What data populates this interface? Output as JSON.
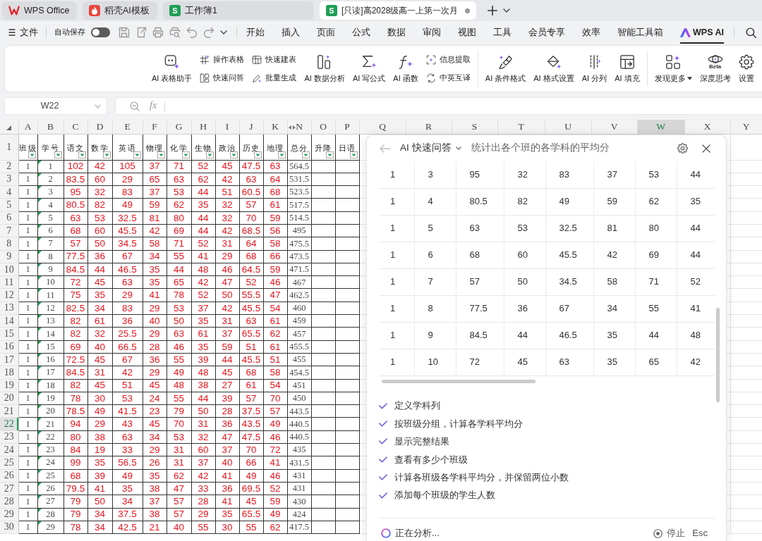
{
  "tabs": [
    {
      "title": "WPS Office",
      "kind": "wps",
      "selected": false,
      "modified": false
    },
    {
      "title": "稻壳AI模板",
      "kind": "docer",
      "selected": false,
      "modified": false
    },
    {
      "title": "工作簿1",
      "kind": "sheet",
      "logo": "S",
      "selected": false,
      "modified": false
    },
    {
      "title": "[只读]高2028级高一上第一次月",
      "kind": "sheet",
      "logo": "S",
      "selected": true,
      "modified": true
    }
  ],
  "menu": {
    "file": "文件",
    "autosave": {
      "label": "自动保存",
      "on": false
    },
    "tabs": [
      {
        "label": "开始",
        "kind": "plain",
        "selected": false
      },
      {
        "label": "插入",
        "kind": "plain",
        "selected": false
      },
      {
        "label": "页面",
        "kind": "plain",
        "selected": false
      },
      {
        "label": "公式",
        "kind": "plain",
        "selected": false
      },
      {
        "label": "数据",
        "kind": "plain",
        "selected": false
      },
      {
        "label": "审阅",
        "kind": "plain",
        "selected": false
      },
      {
        "label": "视图",
        "kind": "plain",
        "selected": false
      },
      {
        "label": "工具",
        "kind": "plain",
        "selected": false
      },
      {
        "label": "会员专享",
        "kind": "plain",
        "selected": false
      },
      {
        "label": "效率",
        "kind": "plain",
        "selected": false
      },
      {
        "label": "智能工具箱",
        "kind": "plain",
        "selected": false
      },
      {
        "label": "WPS AI",
        "kind": "ai",
        "selected": true
      }
    ]
  },
  "ribbon": {
    "groups": [
      [
        {
          "kind": "large",
          "label": "AI 表格助手"
        },
        {
          "kind": "pair",
          "items": [
            "操作表格",
            "快速问答"
          ]
        },
        {
          "kind": "pair",
          "items": [
            "快速建表",
            "批量生成"
          ]
        },
        {
          "kind": "large",
          "label": "AI 数据分析"
        },
        {
          "kind": "large",
          "label": "AI 写公式"
        },
        {
          "kind": "large",
          "label": "AI 函数"
        },
        {
          "kind": "pair",
          "items": [
            "信息提取",
            "中英互译"
          ]
        }
      ],
      [
        {
          "kind": "large",
          "label": "AI 条件格式"
        },
        {
          "kind": "large",
          "label": "AI 格式设置"
        },
        {
          "kind": "large",
          "label": "AI 分列"
        },
        {
          "kind": "large",
          "label": "AI 填充"
        }
      ],
      [
        {
          "kind": "large",
          "label": "发现更多",
          "menu": true
        },
        {
          "kind": "large",
          "label": "深度思考",
          "badge": "Beta"
        },
        {
          "kind": "large",
          "label": "设置"
        }
      ]
    ]
  },
  "formula_bar": {
    "name_box": "W22",
    "function_label": "fx"
  },
  "sheet": {
    "header_row": "1",
    "columns": [
      {
        "letter": "A",
        "header": "班级",
        "kind": "plain",
        "selected": false
      },
      {
        "letter": "B",
        "header": "学号",
        "kind": "text",
        "selected": false
      },
      {
        "letter": "C",
        "header": "语文",
        "kind": "score",
        "selected": false
      },
      {
        "letter": "D",
        "header": "数学",
        "kind": "score",
        "selected": false
      },
      {
        "letter": "E",
        "header": "英语",
        "kind": "score",
        "selected": false
      },
      {
        "letter": "F",
        "header": "物理",
        "kind": "score",
        "selected": false
      },
      {
        "letter": "G",
        "header": "化学",
        "kind": "score",
        "selected": false
      },
      {
        "letter": "H",
        "header": "生物",
        "kind": "score",
        "selected": false
      },
      {
        "letter": "I",
        "header": "政治",
        "kind": "score",
        "selected": false
      },
      {
        "letter": "J",
        "header": "历史",
        "kind": "score",
        "selected": false
      },
      {
        "letter": "K",
        "header": "地理",
        "kind": "score",
        "selected": false
      },
      {
        "letter": "N",
        "header": "总分",
        "kind": "plain",
        "selected": false,
        "hidden_before": true
      },
      {
        "letter": "O",
        "header": "升降",
        "kind": "plain",
        "selected": false
      },
      {
        "letter": "P",
        "header": "日语",
        "kind": "plain",
        "selected": false
      }
    ],
    "more_columns": [
      {
        "letter": "Q",
        "selected": false
      },
      {
        "letter": "R",
        "selected": false
      },
      {
        "letter": "S",
        "selected": false
      },
      {
        "letter": "T",
        "selected": false
      },
      {
        "letter": "U",
        "selected": false
      },
      {
        "letter": "V",
        "selected": false
      },
      {
        "letter": "W",
        "selected": true
      },
      {
        "letter": "X",
        "selected": false
      },
      {
        "letter": "Y",
        "selected": false
      }
    ],
    "rows": [
      {
        "number": "2",
        "selected": false,
        "error_mark": true,
        "cells": [
          "1",
          "1",
          "102",
          "42",
          "105",
          "37",
          "71",
          "52",
          "45",
          "47.5",
          "63",
          "564.5"
        ]
      },
      {
        "number": "3",
        "selected": false,
        "error_mark": true,
        "cells": [
          "1",
          "2",
          "83.5",
          "60",
          "29",
          "65",
          "63",
          "62",
          "42",
          "63",
          "64",
          "531.5"
        ]
      },
      {
        "number": "4",
        "selected": false,
        "error_mark": true,
        "cells": [
          "1",
          "3",
          "95",
          "32",
          "83",
          "37",
          "53",
          "44",
          "51",
          "60.5",
          "68",
          "523.5"
        ]
      },
      {
        "number": "5",
        "selected": false,
        "error_mark": true,
        "cells": [
          "1",
          "4",
          "80.5",
          "82",
          "49",
          "59",
          "62",
          "35",
          "32",
          "57",
          "61",
          "517.5"
        ]
      },
      {
        "number": "6",
        "selected": false,
        "error_mark": true,
        "cells": [
          "1",
          "5",
          "63",
          "53",
          "32.5",
          "81",
          "80",
          "44",
          "32",
          "70",
          "59",
          "514.5"
        ]
      },
      {
        "number": "7",
        "selected": false,
        "error_mark": true,
        "cells": [
          "1",
          "6",
          "68",
          "60",
          "45.5",
          "42",
          "69",
          "44",
          "42",
          "68.5",
          "56",
          "495"
        ]
      },
      {
        "number": "8",
        "selected": false,
        "error_mark": true,
        "cells": [
          "1",
          "7",
          "57",
          "50",
          "34.5",
          "58",
          "71",
          "52",
          "31",
          "64",
          "58",
          "475.5"
        ]
      },
      {
        "number": "9",
        "selected": false,
        "error_mark": true,
        "cells": [
          "1",
          "8",
          "77.5",
          "36",
          "67",
          "34",
          "55",
          "41",
          "29",
          "68",
          "66",
          "473.5"
        ]
      },
      {
        "number": "10",
        "selected": false,
        "error_mark": true,
        "cells": [
          "1",
          "9",
          "84.5",
          "44",
          "46.5",
          "35",
          "44",
          "48",
          "46",
          "64.5",
          "59",
          "471.5"
        ]
      },
      {
        "number": "11",
        "selected": false,
        "error_mark": true,
        "cells": [
          "1",
          "10",
          "72",
          "45",
          "63",
          "35",
          "65",
          "42",
          "47",
          "52",
          "46",
          "467"
        ]
      },
      {
        "number": "12",
        "selected": false,
        "error_mark": true,
        "cells": [
          "1",
          "11",
          "75",
          "35",
          "29",
          "41",
          "78",
          "52",
          "50",
          "55.5",
          "47",
          "462.5"
        ]
      },
      {
        "number": "13",
        "selected": false,
        "error_mark": true,
        "cells": [
          "1",
          "12",
          "82.5",
          "34",
          "83",
          "29",
          "53",
          "37",
          "42",
          "45.5",
          "54",
          "460"
        ]
      },
      {
        "number": "14",
        "selected": false,
        "error_mark": true,
        "cells": [
          "1",
          "13",
          "82",
          "61",
          "36",
          "40",
          "50",
          "35",
          "31",
          "63",
          "61",
          "459"
        ]
      },
      {
        "number": "15",
        "selected": false,
        "error_mark": true,
        "cells": [
          "1",
          "14",
          "82",
          "32",
          "25.5",
          "29",
          "63",
          "61",
          "37",
          "65.5",
          "62",
          "457"
        ]
      },
      {
        "number": "16",
        "selected": false,
        "error_mark": true,
        "cells": [
          "1",
          "15",
          "69",
          "40",
          "66.5",
          "28",
          "46",
          "35",
          "59",
          "51",
          "61",
          "455.5"
        ]
      },
      {
        "number": "17",
        "selected": false,
        "error_mark": true,
        "cells": [
          "1",
          "16",
          "72.5",
          "45",
          "67",
          "36",
          "55",
          "39",
          "44",
          "45.5",
          "51",
          "455"
        ]
      },
      {
        "number": "18",
        "selected": false,
        "error_mark": true,
        "cells": [
          "1",
          "17",
          "84.5",
          "31",
          "42",
          "29",
          "49",
          "48",
          "45",
          "68",
          "58",
          "454.5"
        ]
      },
      {
        "number": "19",
        "selected": false,
        "error_mark": true,
        "cells": [
          "1",
          "18",
          "82",
          "45",
          "51",
          "45",
          "48",
          "38",
          "27",
          "61",
          "54",
          "451"
        ]
      },
      {
        "number": "20",
        "selected": false,
        "error_mark": true,
        "cells": [
          "1",
          "19",
          "78",
          "30",
          "53",
          "24",
          "55",
          "44",
          "39",
          "57",
          "70",
          "450"
        ]
      },
      {
        "number": "21",
        "selected": false,
        "error_mark": true,
        "cells": [
          "1",
          "20",
          "78.5",
          "49",
          "41.5",
          "23",
          "79",
          "50",
          "28",
          "37.5",
          "57",
          "443.5"
        ]
      },
      {
        "number": "22",
        "selected": true,
        "error_mark": true,
        "cells": [
          "1",
          "21",
          "94",
          "29",
          "43",
          "45",
          "70",
          "31",
          "36",
          "43.5",
          "49",
          "440.5"
        ]
      },
      {
        "number": "23",
        "selected": false,
        "error_mark": true,
        "cells": [
          "1",
          "22",
          "80",
          "38",
          "63",
          "34",
          "53",
          "32",
          "47",
          "47.5",
          "46",
          "440.5"
        ]
      },
      {
        "number": "24",
        "selected": false,
        "error_mark": true,
        "cells": [
          "1",
          "23",
          "84",
          "19",
          "33",
          "29",
          "31",
          "60",
          "37",
          "70",
          "72",
          "435"
        ]
      },
      {
        "number": "25",
        "selected": false,
        "error_mark": true,
        "cells": [
          "1",
          "24",
          "99",
          "35",
          "56.5",
          "26",
          "31",
          "37",
          "40",
          "66",
          "41",
          "431.5"
        ]
      },
      {
        "number": "26",
        "selected": false,
        "error_mark": true,
        "cells": [
          "1",
          "25",
          "68",
          "39",
          "49",
          "35",
          "62",
          "42",
          "41",
          "49",
          "46",
          "431"
        ]
      },
      {
        "number": "27",
        "selected": false,
        "error_mark": true,
        "cells": [
          "1",
          "26",
          "79.5",
          "41",
          "35",
          "38",
          "47",
          "33",
          "36",
          "69.5",
          "52",
          "431"
        ]
      },
      {
        "number": "28",
        "selected": false,
        "error_mark": true,
        "cells": [
          "1",
          "27",
          "79",
          "50",
          "34",
          "37",
          "57",
          "28",
          "41",
          "45",
          "59",
          "430"
        ]
      },
      {
        "number": "29",
        "selected": false,
        "error_mark": true,
        "cells": [
          "1",
          "28",
          "79",
          "34",
          "37.5",
          "38",
          "57",
          "29",
          "35",
          "65.5",
          "49",
          "424"
        ]
      },
      {
        "number": "30",
        "selected": false,
        "error_mark": true,
        "cells": [
          "1",
          "29",
          "78",
          "34",
          "42.5",
          "21",
          "40",
          "55",
          "30",
          "55",
          "62",
          "417.5"
        ]
      }
    ]
  },
  "ai_panel": {
    "mode": "AI 快速问答",
    "query": "统计出各个班的各学科的平均分",
    "rows": [
      [
        "1",
        "3",
        "95",
        "32",
        "83",
        "37",
        "53",
        "44"
      ],
      [
        "1",
        "4",
        "80.5",
        "82",
        "49",
        "59",
        "62",
        "35"
      ],
      [
        "1",
        "5",
        "63",
        "53",
        "32.5",
        "81",
        "80",
        "44"
      ],
      [
        "1",
        "6",
        "68",
        "60",
        "45.5",
        "42",
        "69",
        "44"
      ],
      [
        "1",
        "7",
        "57",
        "50",
        "34.5",
        "58",
        "71",
        "52"
      ],
      [
        "1",
        "8",
        "77.5",
        "36",
        "67",
        "34",
        "55",
        "41"
      ],
      [
        "1",
        "9",
        "84.5",
        "44",
        "46.5",
        "35",
        "44",
        "48"
      ],
      [
        "1",
        "10",
        "72",
        "45",
        "63",
        "35",
        "65",
        "42"
      ]
    ],
    "steps": [
      {
        "text": "定义学科列",
        "done": true
      },
      {
        "text": "按班级分组，计算各学科平均分",
        "done": true
      },
      {
        "text": "显示完整结果",
        "done": true
      },
      {
        "text": "查看有多少个班级",
        "done": true
      },
      {
        "text": "计算各班级各学科平均分，并保留两位小数",
        "done": true
      },
      {
        "text": "添加每个班级的学生人数",
        "done": true
      }
    ],
    "status": "正在分析...",
    "stop": {
      "label": "停止",
      "shortcut": "Esc"
    }
  }
}
